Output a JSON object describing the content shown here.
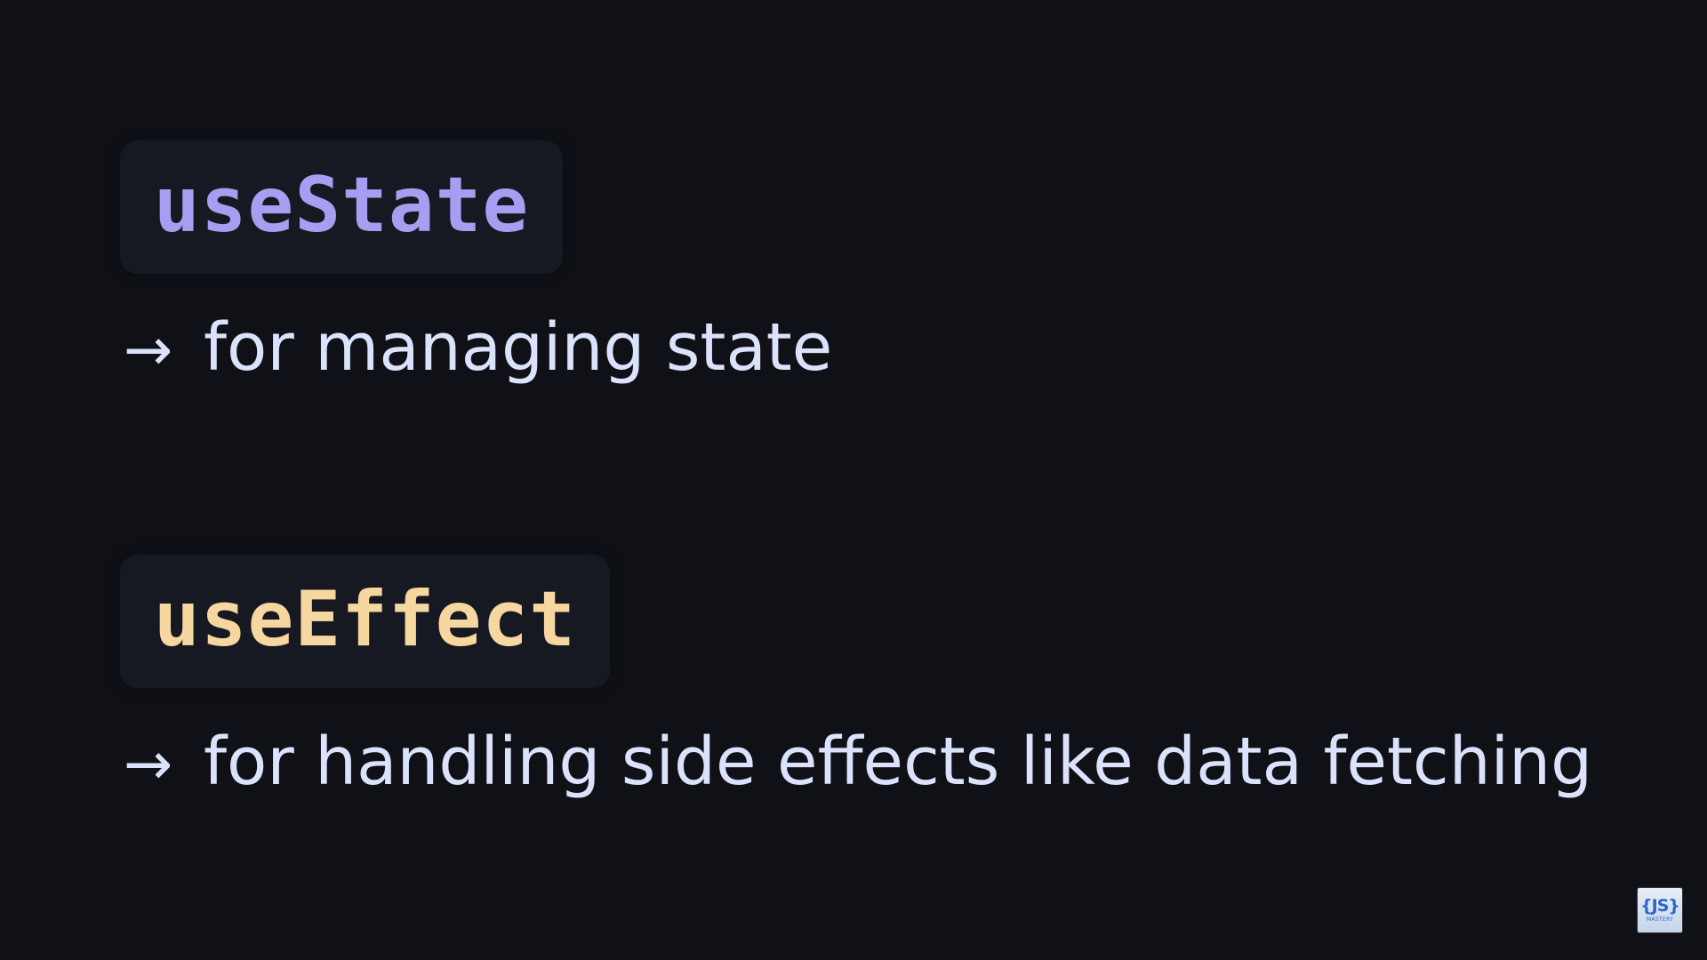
{
  "slide": {
    "background_color": "#0f1117",
    "hooks": [
      {
        "name": "useState",
        "color": "#a79ef2",
        "arrow_icon": "right-arrow-icon",
        "arrow_glyph": "→",
        "description": "for managing state"
      },
      {
        "name": "useEffect",
        "color": "#f7d7a0",
        "arrow_icon": "right-arrow-icon",
        "arrow_glyph": "→",
        "description": "for handling side effects like data fetching"
      }
    ]
  },
  "logo": {
    "icon": "jsm-logo-icon",
    "main_text": "{JS}",
    "sub_text": "MASTERY"
  }
}
